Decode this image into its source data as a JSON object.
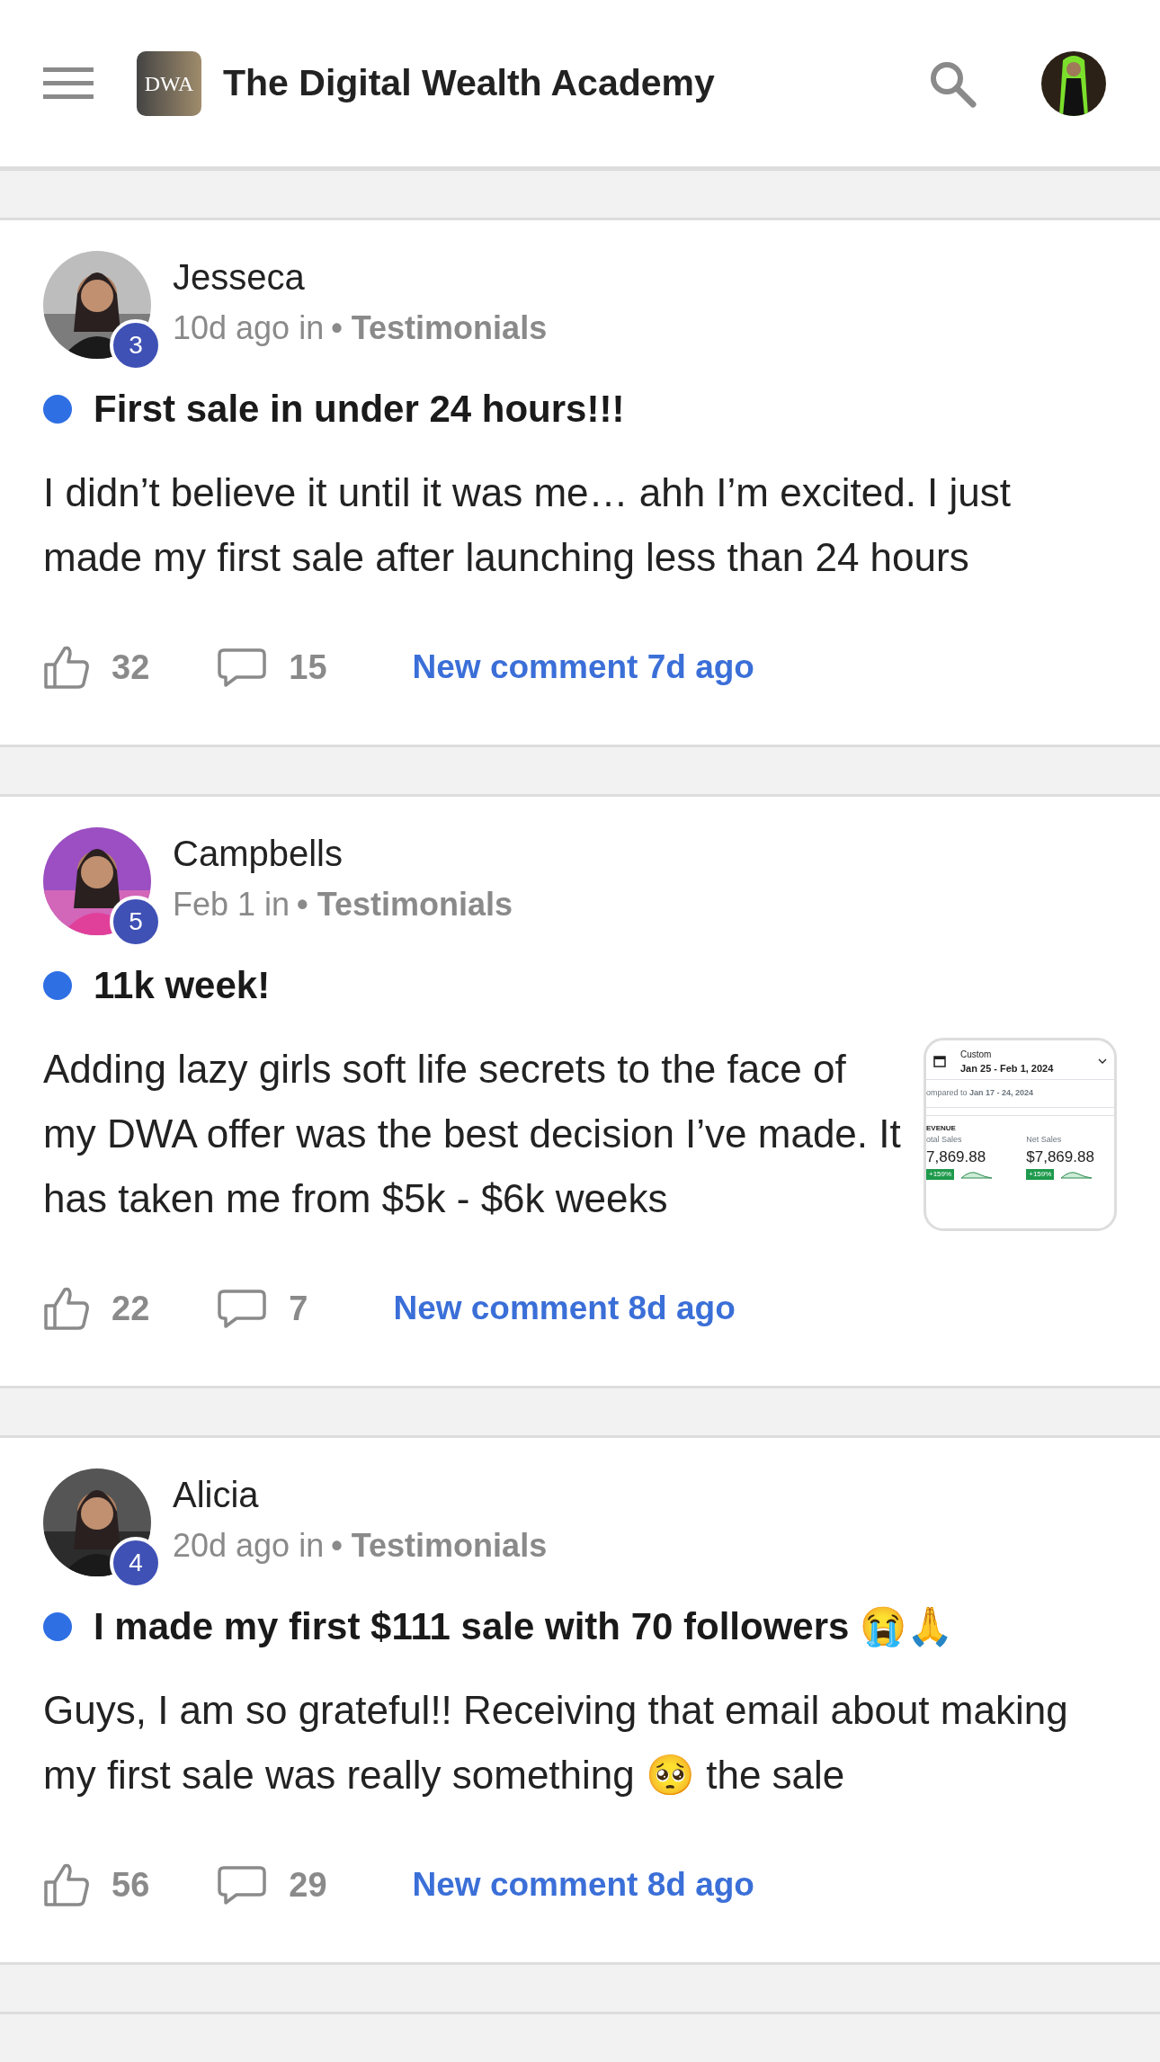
{
  "header": {
    "logo_text": "DWA",
    "title": "The Digital Wealth Academy"
  },
  "posts": [
    {
      "author": "Jesseca",
      "badge": "3",
      "time": "10d ago in",
      "category": "• Testimonials",
      "unread": true,
      "title": "First sale in under 24 hours!!!",
      "body": "I didn’t believe it until it was me… ahh I’m excited. I just made my first sale after launching less than 24 hours",
      "likes": "32",
      "comments": "15",
      "last_comment": "New comment 7d ago"
    },
    {
      "author": "Campbells",
      "badge": "5",
      "time": "Feb 1 in",
      "category": "• Testimonials",
      "unread": true,
      "title": "11k week!",
      "body": "Adding lazy girls soft life secrets to the face of my DWA offer was the best decision I’ve made. It has taken me from $5k - $6k weeks",
      "likes": "22",
      "comments": "7",
      "last_comment": "New comment 8d ago",
      "thumbnail": {
        "kind": "screenshot",
        "label": "Custom",
        "range": "Jan 25 - Feb 1, 2024",
        "compared": "ompared to **Jan 17 - 24, 2024**",
        "section": "EVENUE",
        "metrics": [
          {
            "label": "otal Sales",
            "value": "7,869.88",
            "change": "+159%"
          },
          {
            "label": "Net Sales",
            "value": "$7,869.88",
            "change": "+159%"
          }
        ]
      }
    },
    {
      "author": "Alicia",
      "badge": "4",
      "time": "20d ago in",
      "category": "• Testimonials",
      "unread": true,
      "title": "I made my first $111 sale with 70 followers 😭🙏",
      "body": "Guys, I am so grateful!! Receiving that email about making my first sale was really something 🥺 the sale",
      "likes": "56",
      "comments": "29",
      "last_comment": "New comment 8d ago"
    }
  ]
}
